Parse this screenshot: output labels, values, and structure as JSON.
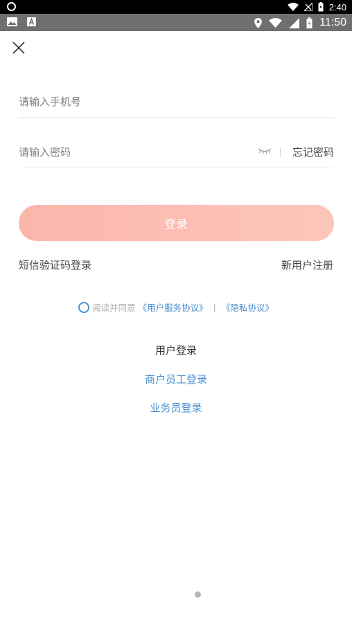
{
  "system_status": {
    "time_top": "2:40",
    "time": "11:50"
  },
  "form": {
    "phone_placeholder": "请输入手机号",
    "password_placeholder": "请输入密码",
    "forgot_label": "忘记密码",
    "login_label": "登录",
    "sms_login_label": "短信验证码登录",
    "register_label": "新用户注册"
  },
  "agreement": {
    "prefix": "阅读并同意",
    "terms_link": "《用户服务协议》",
    "separator": "|",
    "privacy_link": "《隐私协议》"
  },
  "roles": {
    "user": "用户登录",
    "merchant_staff": "商户员工登录",
    "salesperson": "业务员登录"
  },
  "colors": {
    "accent_blue": "#4a8fd0",
    "login_button": "#fbb6aa"
  },
  "icons": [
    "close-icon",
    "eye-closed-icon",
    "radio-unchecked-icon",
    "wifi-icon",
    "signal-icon",
    "battery-icon",
    "location-icon"
  ]
}
